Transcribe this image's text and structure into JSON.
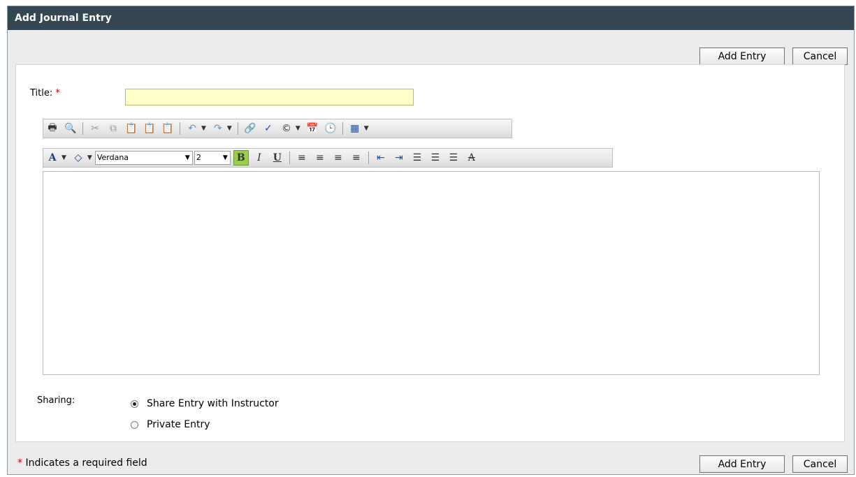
{
  "dialog": {
    "title": "Add Journal Entry"
  },
  "actions": {
    "add_entry_label": "Add Entry",
    "cancel_label": "Cancel"
  },
  "form": {
    "title_label": "Title:",
    "required_mark": "*",
    "title_value": ""
  },
  "editor": {
    "font_value": "Verdana",
    "size_value": "2",
    "bold_glyph": "B",
    "italic_glyph": "I",
    "underline_glyph": "U",
    "font_color_glyph": "A",
    "body_value": ""
  },
  "sharing": {
    "label": "Sharing:",
    "options": [
      {
        "label": "Share Entry with Instructor",
        "checked": true
      },
      {
        "label": "Private Entry",
        "checked": false
      }
    ]
  },
  "footer": {
    "required_mark": "*",
    "note": " Indicates a required field"
  }
}
